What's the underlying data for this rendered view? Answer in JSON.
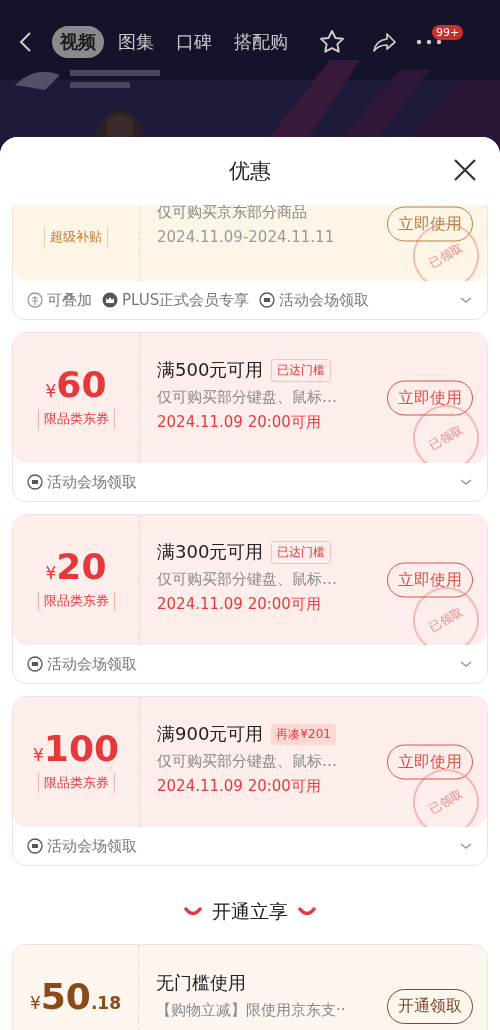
{
  "top_bar": {
    "tabs": [
      {
        "label": "视频",
        "selected": true
      },
      {
        "label": "图集",
        "selected": false
      },
      {
        "label": "口碑",
        "selected": false
      },
      {
        "label": "搭配购",
        "selected": false
      }
    ],
    "badge": "99+"
  },
  "sheet": {
    "title": "优惠"
  },
  "coupons": [
    {
      "kind": "subsidy",
      "tag": "超级补贴",
      "desc": "仅可购买京东部分商品",
      "date": "2024.11.09-2024.11.11",
      "button": "立即使用",
      "claimed": true,
      "stamp": "已领取",
      "footer": [
        {
          "kind": "stackable",
          "label": "可叠加"
        },
        {
          "kind": "plus",
          "label": "PLUS正式会员专享"
        },
        {
          "kind": "venue",
          "label": "活动会场领取"
        }
      ]
    },
    {
      "kind": "category",
      "amount": "60",
      "symbol": "¥",
      "tag": "限品类东券",
      "condition": "满500元可用",
      "threshold": {
        "kind": "reached",
        "text": "已达门槛"
      },
      "desc": "仅可购买部分键盘、鼠标…",
      "date": "2024.11.09 20:00可用",
      "button": "立即使用",
      "claimed": true,
      "stamp": "已领取",
      "footer": [
        {
          "kind": "venue",
          "label": "活动会场领取"
        }
      ]
    },
    {
      "kind": "category",
      "amount": "20",
      "symbol": "¥",
      "tag": "限品类东券",
      "condition": "满300元可用",
      "threshold": {
        "kind": "reached",
        "text": "已达门槛"
      },
      "desc": "仅可购买部分键盘、鼠标…",
      "date": "2024.11.09 20:00可用",
      "button": "立即使用",
      "claimed": true,
      "stamp": "已领取",
      "footer": [
        {
          "kind": "venue",
          "label": "活动会场领取"
        }
      ]
    },
    {
      "kind": "category",
      "amount": "100",
      "symbol": "¥",
      "tag": "限品类东券",
      "condition": "满900元可用",
      "threshold": {
        "kind": "short",
        "text": "再凑¥201"
      },
      "desc": "仅可购买部分键盘、鼠标…",
      "date": "2024.11.09 20:00可用",
      "button": "立即使用",
      "claimed": true,
      "stamp": "已领取",
      "footer": [
        {
          "kind": "venue",
          "label": "活动会场领取"
        }
      ]
    }
  ],
  "section_title": "开通立享",
  "extra_coupon": {
    "kind": "membership",
    "symbol": "¥",
    "amount": "50",
    "decimal": ".18",
    "condition": "无门槛使用",
    "desc": "【购物立减】限使用京东支··",
    "button": "开通领取"
  }
}
